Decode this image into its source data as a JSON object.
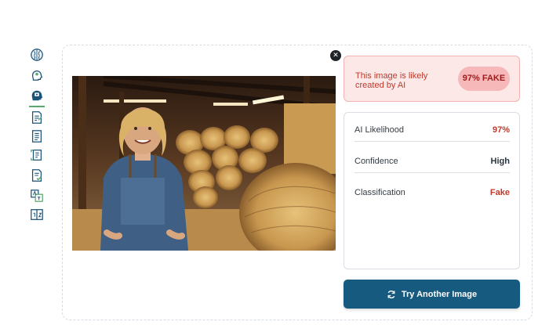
{
  "sidebar": {
    "items": [
      {
        "icon": "brain-icon"
      },
      {
        "icon": "head-profile-icon"
      },
      {
        "icon": "ai-head-icon",
        "active": true
      },
      {
        "icon": "document-edit-icon"
      },
      {
        "icon": "document-list-icon"
      },
      {
        "icon": "document-scan-icon"
      },
      {
        "icon": "document-check-icon"
      },
      {
        "icon": "translate-icon"
      },
      {
        "icon": "compare-icon"
      }
    ],
    "active_color": "#5aa86f"
  },
  "image_panel": {
    "close_icon": "close-icon",
    "close_symbol": "✕"
  },
  "verdict": {
    "message": "This image is likely created by AI",
    "badge": "97% FAKE",
    "color": "#c0392b"
  },
  "stats": [
    {
      "label": "AI Likelihood",
      "value": "97%",
      "color": "#c0392b"
    },
    {
      "label": "Confidence",
      "value": "High",
      "color": "#2a3540"
    },
    {
      "label": "Classification",
      "value": "Fake",
      "color": "#c0392b"
    }
  ],
  "action": {
    "label": "Try Another Image",
    "icon": "refresh-icon",
    "color": "#175a80"
  }
}
